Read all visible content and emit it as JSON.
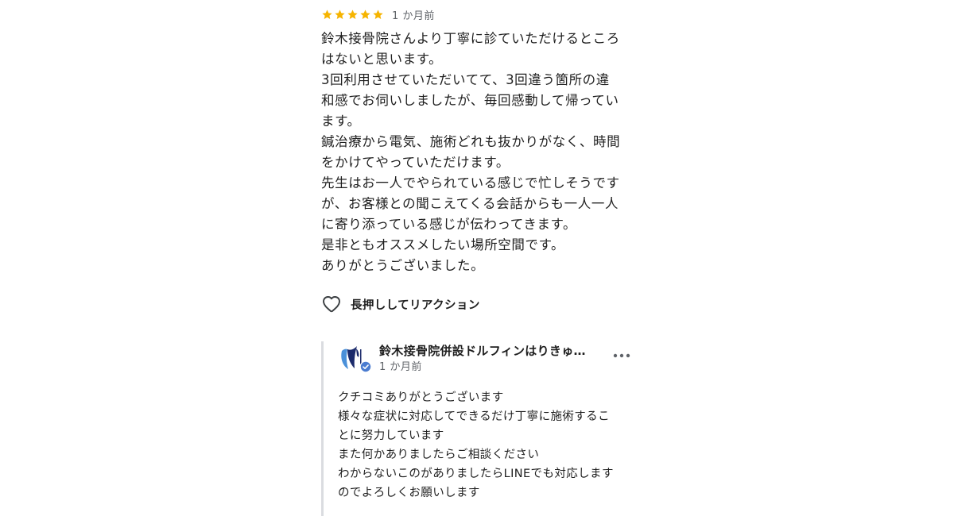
{
  "review": {
    "rating": 5,
    "star_color": "#f6b400",
    "date": "1 か月前",
    "body_lines": [
      "鈴木接骨院さんより丁寧に診ていただけるところ",
      "はないと思います。",
      "3回利用させていただいてて、3回違う箇所の違",
      "和感でお伺いしましたが、毎回感動して帰ってい",
      "ます。",
      "鍼治療から電気、施術どれも抜かりがなく、時間",
      "をかけてやっていただけます。",
      "先生はお一人でやられている感じで忙しそうです",
      "が、お客様との聞こえてくる会話からも一人一人",
      "に寄り添っている感じが伝わってきます。",
      "是非ともオススメしたい場所空間です。",
      "ありがとうございました。"
    ],
    "reaction": {
      "icon": "heart-outline-icon",
      "label": "長押ししてリアクション"
    }
  },
  "owner_reply": {
    "avatar_icon": "dolphin-logo-icon",
    "verified_icon": "verified-badge-icon",
    "verified_color": "#4a7bd0",
    "name": "鈴木接骨院併設ドルフィンはりきゅ…",
    "date": "1 か月前",
    "more_icon": "more-horizontal-icon",
    "body_lines": [
      "クチコミありがとうございます",
      "様々な症状に対応してできるだけ丁寧に施術するこ",
      "とに努力しています",
      "また何かありましたらご相談ください",
      "わからないこのがありましたらLINEでも対応します",
      "のでよろしくお願いします"
    ]
  }
}
